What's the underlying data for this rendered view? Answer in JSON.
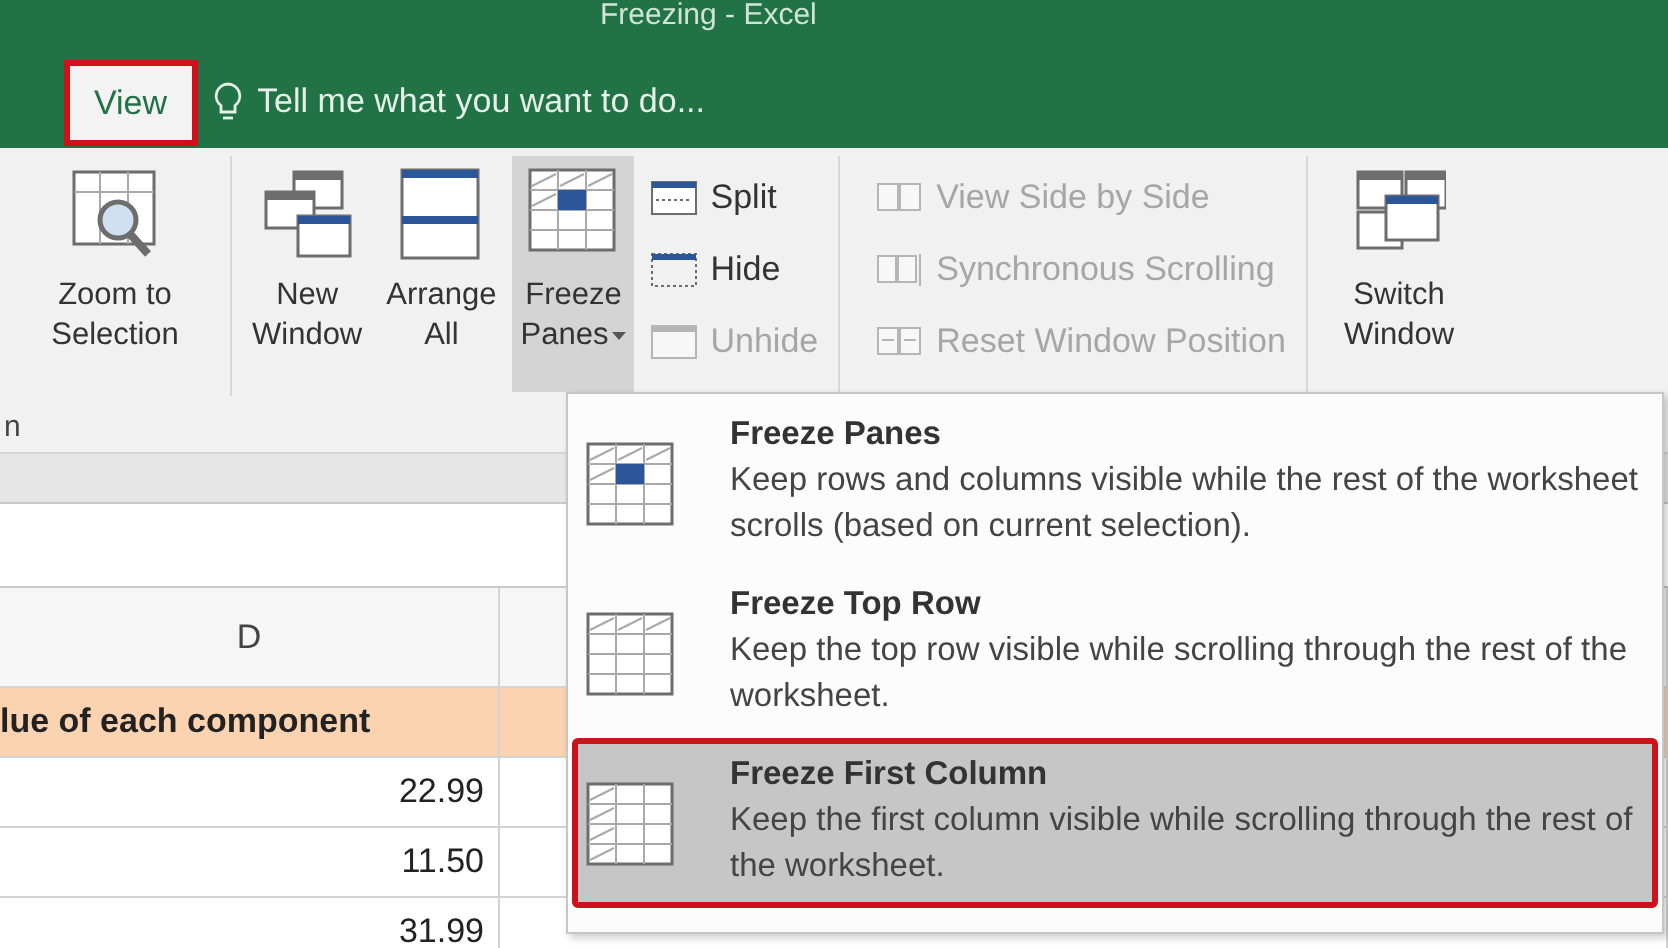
{
  "window": {
    "title": "Freezing - Excel"
  },
  "tabs": [
    {
      "label": "View",
      "selected": true,
      "highlighted": true
    }
  ],
  "tell_me": {
    "placeholder": "Tell me what you want to do..."
  },
  "ribbon": {
    "groups": [
      {
        "label": "n",
        "items": [
          {
            "kind": "large",
            "label": "Zoom to\nSelection"
          }
        ]
      },
      {
        "items": [
          {
            "kind": "large",
            "label": "New\nWindow"
          },
          {
            "kind": "large",
            "label": "Arrange\nAll"
          },
          {
            "kind": "large",
            "label": "Freeze\nPanes",
            "pressed": true,
            "dropdown": true
          },
          {
            "kind": "stack",
            "items": [
              {
                "label": "Split",
                "disabled": false
              },
              {
                "label": "Hide",
                "disabled": false
              },
              {
                "label": "Unhide",
                "disabled": true
              }
            ]
          }
        ]
      },
      {
        "items": [
          {
            "kind": "stack",
            "items": [
              {
                "label": "View Side by Side",
                "disabled": true
              },
              {
                "label": "Synchronous Scrolling",
                "disabled": true
              },
              {
                "label": "Reset Window Position",
                "disabled": true
              }
            ]
          }
        ]
      },
      {
        "items": [
          {
            "kind": "large",
            "label": "Switch\nWindow"
          }
        ]
      }
    ]
  },
  "sheet": {
    "column_header": "D",
    "rows": [
      {
        "kind": "header",
        "cell": "lue of each component"
      },
      {
        "kind": "number",
        "cell": "22.99"
      },
      {
        "kind": "number",
        "cell": "11.50"
      },
      {
        "kind": "number",
        "cell": "31.99"
      }
    ]
  },
  "menu": {
    "items": [
      {
        "title": "Freeze Panes",
        "description": "Keep rows and columns visible while the rest of the worksheet scrolls (based on current selection).",
        "selected": false,
        "highlighted": false
      },
      {
        "title": "Freeze Top Row",
        "description": "Keep the top row visible while scrolling through the rest of the worksheet.",
        "selected": false,
        "highlighted": false
      },
      {
        "title": "Freeze First Column",
        "description": "Keep the first column visible while scrolling through the rest of the worksheet.",
        "selected": true,
        "highlighted": true
      }
    ]
  }
}
